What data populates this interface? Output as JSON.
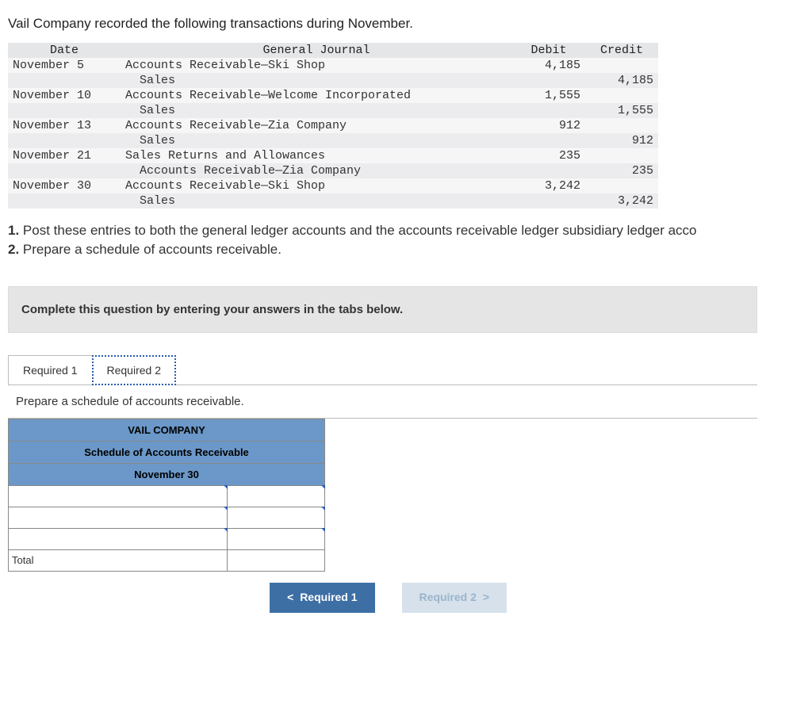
{
  "intro": "Vail Company recorded the following transactions during November.",
  "journal": {
    "headers": {
      "date": "Date",
      "desc": "General Journal",
      "debit": "Debit",
      "credit": "Credit"
    },
    "rows": [
      {
        "date": "November 5",
        "desc": "Accounts Receivable—Ski Shop",
        "debit": "4,185",
        "credit": "",
        "shade": "a"
      },
      {
        "date": "",
        "desc": "  Sales",
        "debit": "",
        "credit": "4,185",
        "shade": "b"
      },
      {
        "date": "November 10",
        "desc": "Accounts Receivable—Welcome Incorporated",
        "debit": "1,555",
        "credit": "",
        "shade": "a"
      },
      {
        "date": "",
        "desc": "  Sales",
        "debit": "",
        "credit": "1,555",
        "shade": "b"
      },
      {
        "date": "November 13",
        "desc": "Accounts Receivable—Zia Company",
        "debit": "912",
        "credit": "",
        "shade": "a"
      },
      {
        "date": "",
        "desc": "  Sales",
        "debit": "",
        "credit": "912",
        "shade": "b"
      },
      {
        "date": "November 21",
        "desc": "Sales Returns and Allowances",
        "debit": "235",
        "credit": "",
        "shade": "a"
      },
      {
        "date": "",
        "desc": "  Accounts Receivable—Zia Company",
        "debit": "",
        "credit": "235",
        "shade": "b"
      },
      {
        "date": "November 30",
        "desc": "Accounts Receivable—Ski Shop",
        "debit": "3,242",
        "credit": "",
        "shade": "a"
      },
      {
        "date": "",
        "desc": "  Sales",
        "debit": "",
        "credit": "3,242",
        "shade": "b"
      }
    ]
  },
  "instructions": {
    "line1_num": "1.",
    "line1_text": " Post these entries to both the general ledger accounts and the accounts receivable ledger subsidiary ledger acco",
    "line2_num": "2.",
    "line2_text": " Prepare a schedule of accounts receivable."
  },
  "shaded_prompt": "Complete this question by entering your answers in the tabs below.",
  "tabs": {
    "req1": "Required 1",
    "req2": "Required 2"
  },
  "sub_instruction": "Prepare a schedule of accounts receivable.",
  "schedule": {
    "h1": "VAIL COMPANY",
    "h2": "Schedule of Accounts Receivable",
    "h3": "November 30",
    "total_label": "Total"
  },
  "nav": {
    "prev": "Required 1",
    "next": "Required 2",
    "chev_left": "<",
    "chev_right": ">"
  }
}
